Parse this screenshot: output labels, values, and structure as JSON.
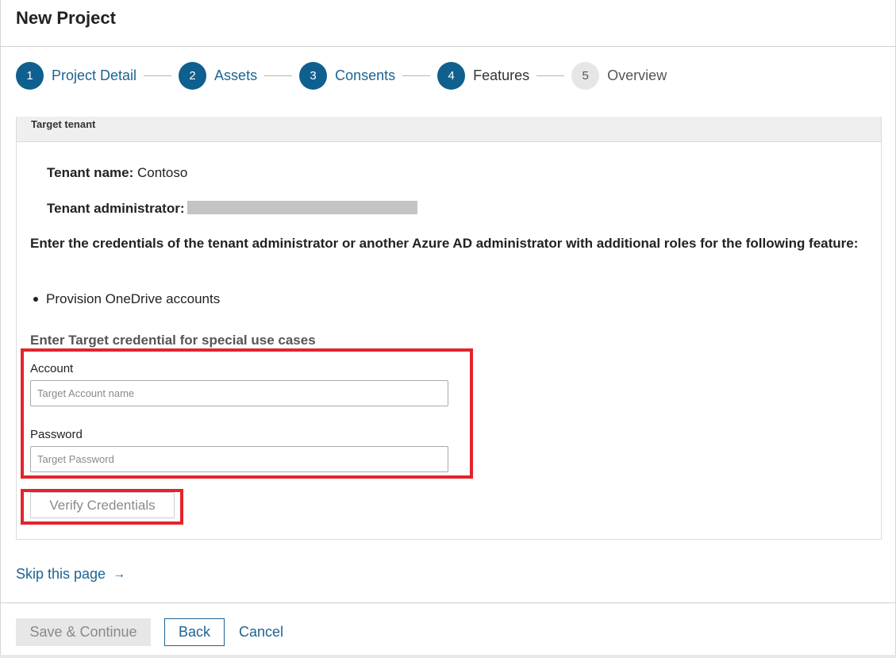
{
  "page": {
    "title": "New Project"
  },
  "stepper": {
    "steps": [
      {
        "number": "1",
        "label": "Project Detail",
        "state": "done"
      },
      {
        "number": "2",
        "label": "Assets",
        "state": "done"
      },
      {
        "number": "3",
        "label": "Consents",
        "state": "done"
      },
      {
        "number": "4",
        "label": "Features",
        "state": "current"
      },
      {
        "number": "5",
        "label": "Overview",
        "state": "pending"
      }
    ]
  },
  "panel": {
    "header": "Target tenant",
    "tenant_name_label": "Tenant name:",
    "tenant_name_value": "Contoso",
    "tenant_admin_label": "Tenant administrator:",
    "instructions": "Enter the credentials of the tenant administrator or another Azure AD administrator with additional roles for the following feature:",
    "features": [
      "Provision OneDrive accounts"
    ],
    "credential_section_label": "Enter Target credential for special use cases",
    "account": {
      "label": "Account",
      "placeholder": "Target Account name",
      "value": ""
    },
    "password": {
      "label": "Password",
      "placeholder": "Target Password",
      "value": ""
    },
    "verify_button": "Verify Credentials"
  },
  "skip_link": {
    "label": "Skip this page",
    "icon": "arrow-right-icon"
  },
  "footer": {
    "save_label": "Save & Continue",
    "back_label": "Back",
    "cancel_label": "Cancel"
  },
  "colors": {
    "accent": "#0f5f8f",
    "link": "#1b6493",
    "highlight": "#e3242b"
  }
}
